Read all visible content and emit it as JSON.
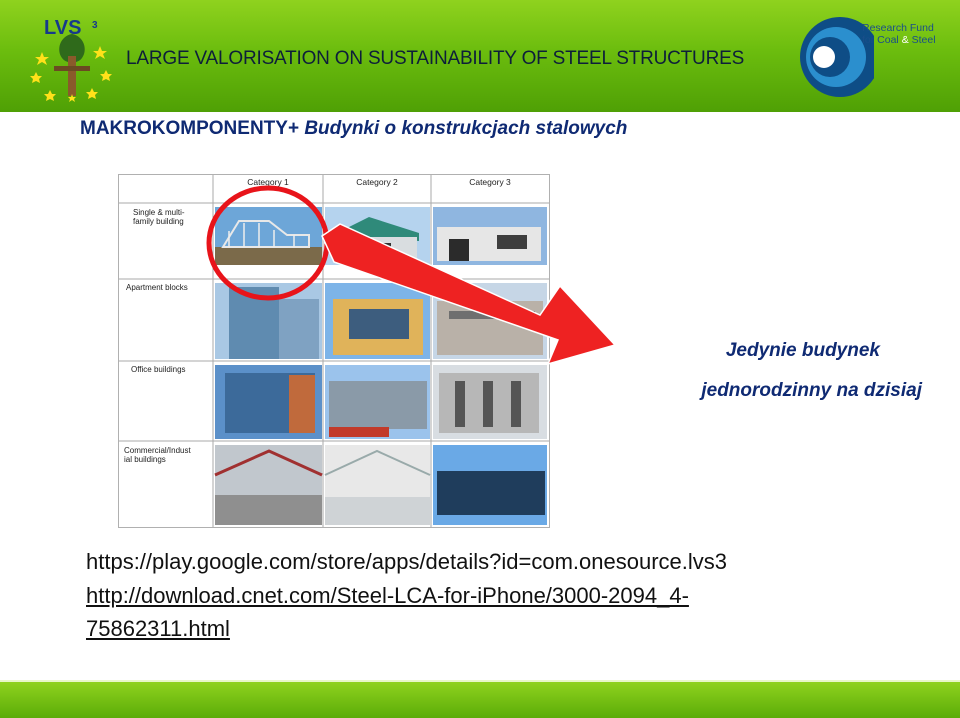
{
  "header": {
    "logo_text": "LVS",
    "logo_sub": "3",
    "title": "LARGE VALORISATION ON SUSTAINABILITY OF STEEL STRUCTURES",
    "rfcs_line1": "Research Fund",
    "rfcs_line2a": "for Coal ",
    "rfcs_amp": "&",
    "rfcs_line2b": " Steel"
  },
  "slide": {
    "title_bold": "MAKROKOMPONENTY+",
    "title_rest": " Budynki o konstrukcjach stalowych"
  },
  "grid": {
    "columns": [
      "Category 1",
      "Category 2",
      "Category 3"
    ],
    "rows": [
      "Single & multi-family building",
      "Apartment blocks",
      "Office buildings",
      "Commercial/Industrial buildings"
    ]
  },
  "callout": {
    "line1": "Jedynie budynek",
    "line2": "jednorodzinny na dzisiaj"
  },
  "links": {
    "line1": "https://play.google.com/store/apps/details?id=com.onesource.lvs3",
    "line2": "http://download.cnet.com/Steel-LCA-for-iPhone/3000-2094_4-",
    "line3": "75862311.html"
  }
}
